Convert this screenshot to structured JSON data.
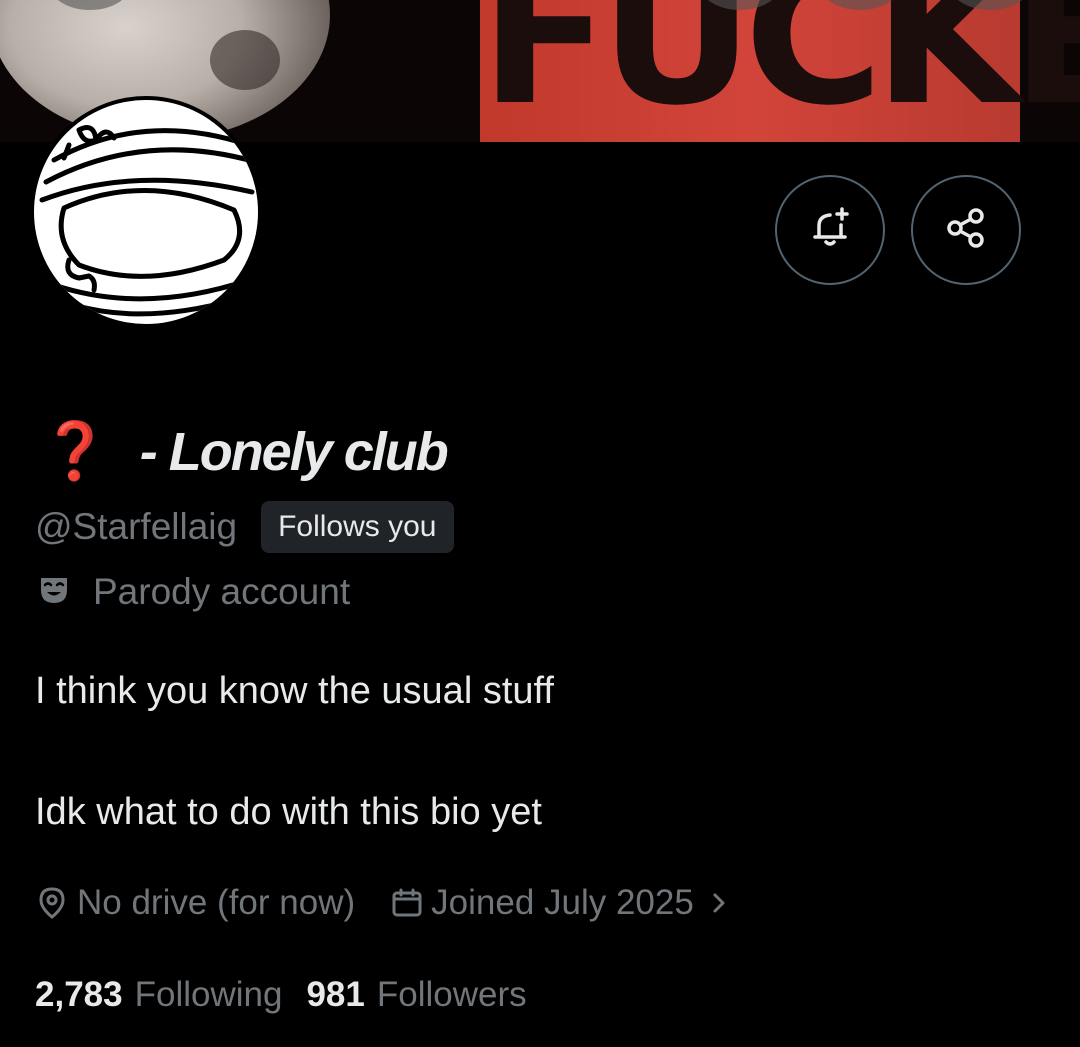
{
  "banner": {
    "text": "FUCKED"
  },
  "profile": {
    "name_emoji": "❓",
    "name": "- Lonely club",
    "handle": "@Starfellaig",
    "follows_badge": "Follows you",
    "parody_label": "Parody account",
    "bio": [
      "I think you know the usual stuff",
      "Idk what to do with this bio yet"
    ],
    "location": "No drive (for now)",
    "joined": "Joined July 2025",
    "following_count": "2,783",
    "following_label": "Following",
    "followers_count": "981",
    "followers_label": "Followers"
  },
  "actions": {
    "notify_icon": "bell-plus-icon",
    "share_icon": "share-icon"
  },
  "colors": {
    "background": "#000000",
    "text_primary": "#e7e9ea",
    "text_secondary": "#71767b",
    "button_border": "#536471",
    "badge_bg": "#202327",
    "banner_red": "#d2443a"
  }
}
